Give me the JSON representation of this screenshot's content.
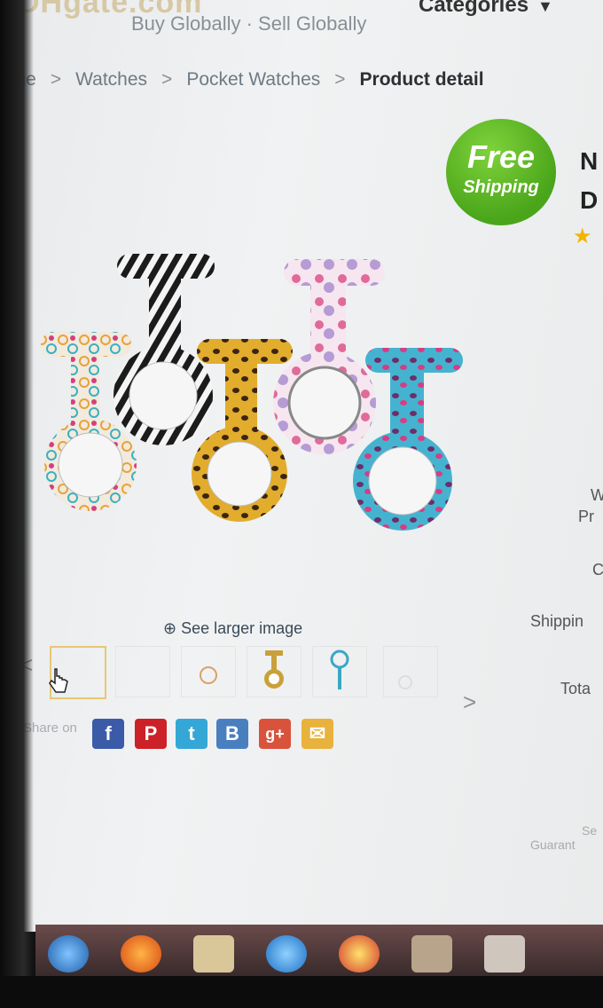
{
  "header": {
    "logo": "DHgate.com",
    "tagline": "Buy Globally · Sell Globally",
    "categories_label": "Categories",
    "categories_caret": "▼"
  },
  "breadcrumb": [
    {
      "label": "ome"
    },
    {
      "label": "Watches"
    },
    {
      "label": "Pocket Watches"
    },
    {
      "label": "Product detail"
    }
  ],
  "breadcrumb_sep": ">",
  "badge": {
    "line1": "Free",
    "line2": "Shipping"
  },
  "product": {
    "title_fragments": [
      "N",
      "D"
    ],
    "star": "★",
    "watches": [
      {
        "name": "circles-watch",
        "color": "#e6b020"
      },
      {
        "name": "zebra-watch",
        "color": "#1e1e1e"
      },
      {
        "name": "leopard-watch",
        "color": "#d7a126"
      },
      {
        "name": "pink-floral-watch",
        "color": "#d86b9a"
      },
      {
        "name": "blue-leopard-watch",
        "color": "#39a8c5"
      }
    ]
  },
  "gallery": {
    "zoom_label": "See larger image",
    "prev": "<",
    "next": ">"
  },
  "share": {
    "label": "Share on",
    "icons": [
      {
        "name": "facebook-icon",
        "glyph": "f",
        "color": "#3b5ba8"
      },
      {
        "name": "pinterest-icon",
        "glyph": "P",
        "color": "#cc2127"
      },
      {
        "name": "twitter-icon",
        "glyph": "t",
        "color": "#35a7d6"
      },
      {
        "name": "blogger-icon",
        "glyph": "B",
        "color": "#4a7fbf"
      },
      {
        "name": "googleplus-icon",
        "glyph": "g+",
        "color": "#d9533c"
      },
      {
        "name": "email-icon",
        "glyph": "✉",
        "color": "#e8b23c"
      }
    ]
  },
  "right_labels": {
    "w": "W",
    "pr": "Pr",
    "c": "C",
    "shipping": "Shippin",
    "total": "Tota",
    "se": "Se",
    "guarant": "Guarant"
  },
  "taskbar": {
    "icons": [
      "start-icon",
      "firefox-icon",
      "folder-icon",
      "ie-icon",
      "chrome-icon",
      "explorer-icon",
      "app-icon"
    ]
  }
}
